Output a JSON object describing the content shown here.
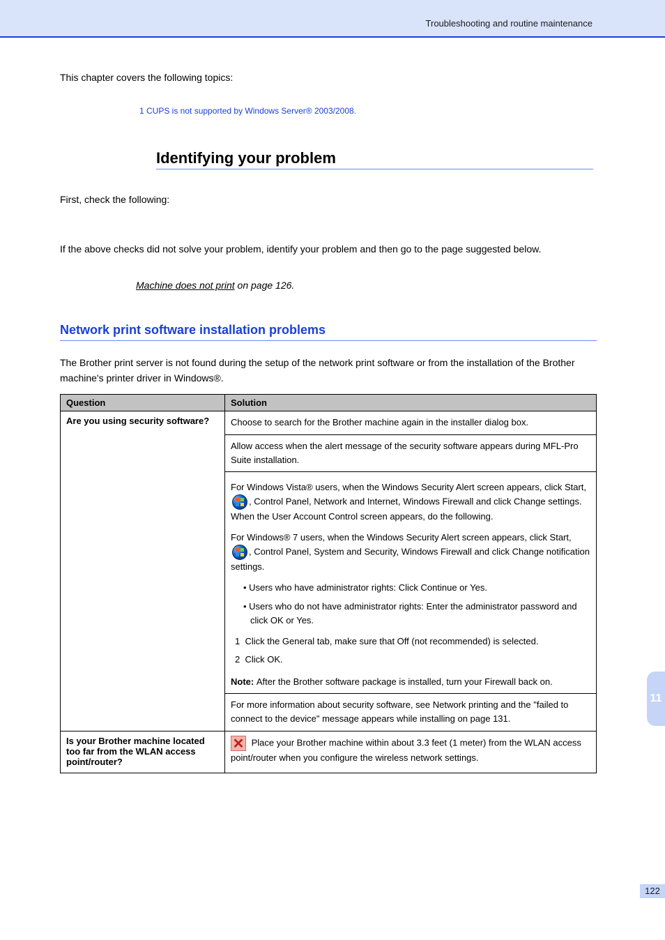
{
  "header": {
    "right_text": "Troubleshooting and routine maintenance"
  },
  "intro": {
    "p1": "This chapter covers the following topics:",
    "footnote": "1  CUPS is not supported by Windows Server® 2003/2008."
  },
  "section": {
    "title": "Identifying your problem",
    "line1": "First, check the following:",
    "line2": "If the above checks did not solve your problem, identify your problem and then go to the page suggested below.",
    "xref_prefix": "Machine does not print",
    "xref_link": " on page 126."
  },
  "subsection": {
    "title": "Network print software installation problems",
    "intro": "The Brother print server is not found during the setup of the network print software or from the installation of the Brother machine's printer driver in Windows®."
  },
  "table": {
    "head": {
      "col1": "Question",
      "col2": "Solution"
    },
    "rows": [
      {
        "q_title": "Are you using security software?",
        "q_body": "",
        "answers": [
          {
            "text": "Choose to search for the Brother machine again in the installer dialog box."
          },
          {
            "text": "Allow access when the alert message of the security software appears during MFL-Pro Suite installation."
          },
          {
            "html": true,
            "vistahdr1": "For Windows Vista® users, when the Windows Security Alert screen appears, click Start,",
            "vista1": "Control Panel, Network and Internet, Windows Firewall and click Change settings. When the User Account Control screen appears, do the following.",
            "vistahdr2": "For Windows® 7 users, when the Windows Security Alert screen appears, click Start,",
            "vista2": "Control Panel, System and Security, Windows Firewall and click Change notification settings.",
            "bullets": [
              "Users who have administrator rights: Click Continue or Yes.",
              "Users who do not have administrator rights: Enter the administrator password and click OK or Yes."
            ],
            "steps": [
              "Click the General tab, make sure that Off (not recommended) is selected.",
              "Click OK."
            ],
            "note": "After the Brother software package is installed, turn your Firewall back on."
          },
          {
            "text": "For more information about security software, see Network printing and the \"failed to connect to the device\" message appears while installing on page 131."
          }
        ]
      },
      {
        "q_title": "Is your Brother machine located too far from the WLAN access point/router?",
        "answers": [
          {
            "icon": "x",
            "text": "Place your Brother machine within about 3.3 feet (1 meter) from the WLAN access point/router when you configure the wireless network settings."
          }
        ]
      }
    ]
  },
  "side": {
    "tab": "11",
    "page": "122"
  }
}
